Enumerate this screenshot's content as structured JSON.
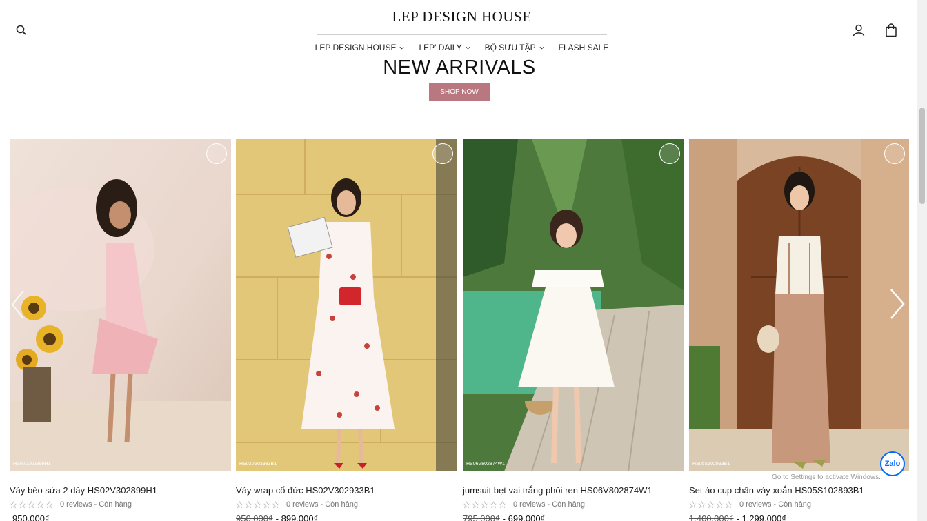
{
  "header": {
    "logo": "LEP DESIGN HOUSE",
    "nav": [
      {
        "label": "LEP DESIGN HOUSE",
        "has_dropdown": true
      },
      {
        "label": "LEP' DAILY",
        "has_dropdown": true
      },
      {
        "label": "BỘ SƯU TẬP",
        "has_dropdown": true
      },
      {
        "label": "FLASH SALE",
        "has_dropdown": false
      }
    ],
    "icons": [
      "search-icon",
      "user-icon",
      "shopping-bag-icon"
    ]
  },
  "hero": {
    "title": "NEW ARRIVALS",
    "button": "SHOP NOW",
    "button_color": "#b9787f"
  },
  "products": [
    {
      "name": "Váy bèo sứa 2 dây HS02V302899H1",
      "sku_tag": "HS02V302899H1",
      "reviews": "0 reviews - Còn hàng",
      "old_price": "",
      "price": "950.000₫"
    },
    {
      "name": "Váy wrap cổ đức HS02V302933B1",
      "sku_tag": "HS02V302933B1",
      "reviews": "0 reviews - Còn hàng",
      "old_price": "950.000₫",
      "price": "- 899.000₫"
    },
    {
      "name": "jumsuit bẹt vai trắng phối ren HS06V802874W1",
      "sku_tag": "HS06V802874W1",
      "reviews": "0 reviews - Còn hàng",
      "old_price": "795.000₫",
      "price": "- 699.000₫"
    },
    {
      "name": "Set áo cup chân váy xoắn HS05S102893B1",
      "sku_tag": "HS05S102893B1",
      "reviews": "0 reviews - Còn hàng",
      "old_price": "1.400.000₫",
      "price": "- 1.299.000₫"
    }
  ],
  "rating_stars": 5,
  "widgets": {
    "zalo": "Zalo",
    "windows_watermark": "Go to Settings to activate Windows."
  }
}
